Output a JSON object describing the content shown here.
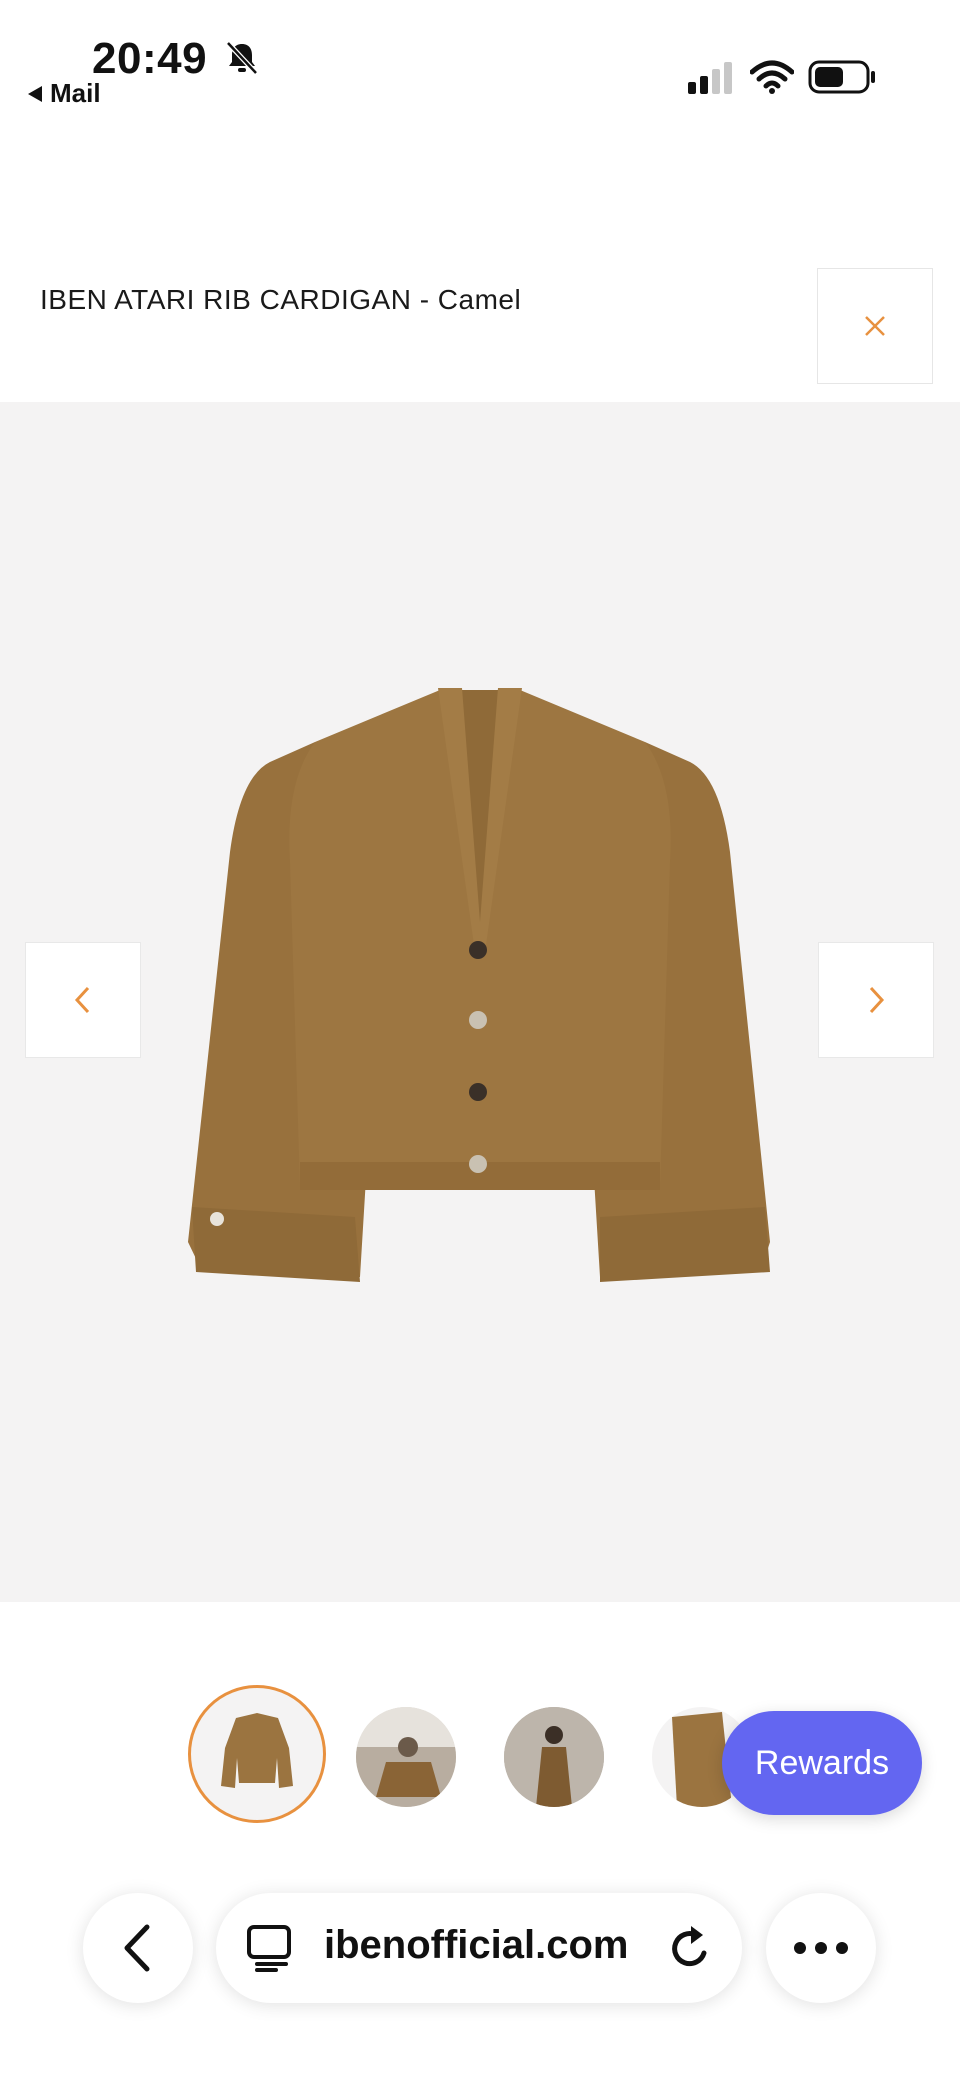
{
  "status": {
    "time": "20:49",
    "back_label": "Mail"
  },
  "product": {
    "title": "IBEN ATARI RIB CARDIGAN - Camel"
  },
  "rewards_label": "Rewards",
  "browser": {
    "url": "ibenofficial.com"
  },
  "colors": {
    "accent": "#e8913f",
    "rewards": "#6366f1",
    "gallery_bg": "#f4f3f3",
    "cardigan": "#9b7440"
  }
}
